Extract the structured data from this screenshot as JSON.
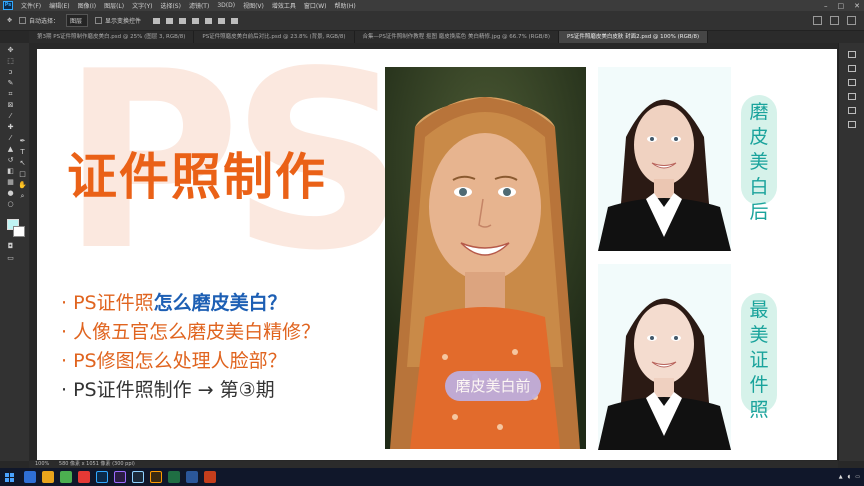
{
  "app": {
    "menu": [
      "文件(F)",
      "编辑(E)",
      "图像(I)",
      "图层(L)",
      "文字(Y)",
      "选择(S)",
      "滤镜(T)",
      "3D(D)",
      "视图(V)",
      "增效工具",
      "窗口(W)",
      "帮助(H)"
    ],
    "logo": "Ps"
  },
  "options": {
    "auto_select": "自动选择：",
    "layer_select": "图层",
    "transform": "显示变换控件"
  },
  "tabs": [
    {
      "label": "第3期 PS证件照制作磨皮美白.psd @ 25% (图层 3, RGB/8)",
      "active": false
    },
    {
      "label": "PS证件照磨皮美白前后对比.psd @ 23.8% (背景, RGB/8)",
      "active": false
    },
    {
      "label": "合集—PS证件照制作教程 抠图 磨皮换底色 美白精修.jpg @ 66.7% (RGB/8)",
      "active": false
    },
    {
      "label": "PS证件照磨皮美白皮肤 封面2.psd @ 100% (RGB/8)",
      "active": true
    }
  ],
  "canvas": {
    "watermark": "PS",
    "title": "证件照制作",
    "bullets": [
      {
        "prefix": "· PS证件照",
        "highlight": "怎么磨皮美白",
        "suffix": "？",
        "style": "orange"
      },
      {
        "prefix": "· 人像五官怎么磨皮美白精修？",
        "highlight": "",
        "suffix": "",
        "style": "orange"
      },
      {
        "prefix": "· PS修图怎么处理人脸部？",
        "highlight": "",
        "suffix": "",
        "style": "orange"
      },
      {
        "prefix": "· PS证件照制作 → 第③期",
        "highlight": "",
        "suffix": "",
        "style": "dark"
      }
    ],
    "tag_before": "磨皮美白前",
    "tag_after": "磨\n皮\n美\n白\n后",
    "tag_best": "最\n美\n证\n件\n照"
  },
  "status": {
    "zoom": "100%",
    "doc": "580 像素 x 1051 像素 (300 ppi)"
  },
  "colors": {
    "accent_orange": "#ea6117",
    "accent_blue": "#1d5fb4",
    "teal": "#1aa39c",
    "tag_bg": "#d6f2ea"
  }
}
